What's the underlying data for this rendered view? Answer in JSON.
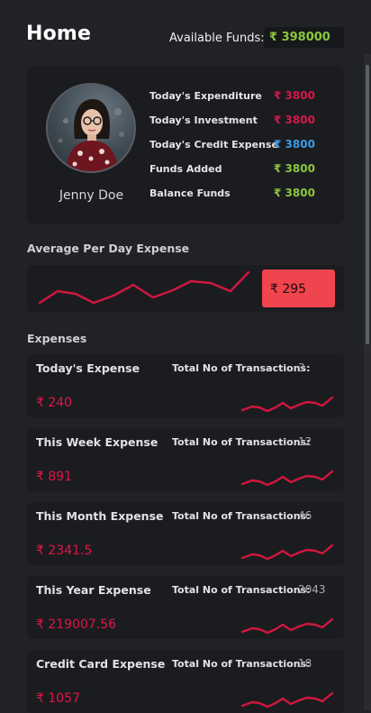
{
  "header": {
    "title": "Home",
    "funds_label": "Available Funds:",
    "funds_value": "₹ 398000"
  },
  "profile": {
    "name": "Jenny Doe",
    "stats": [
      {
        "label": "Today's Expenditure",
        "value": "₹ 3800",
        "color": "#d5184b"
      },
      {
        "label": "Today's Investment",
        "value": "₹ 3800",
        "color": "#d5184b"
      },
      {
        "label": "Today's Credit Expense",
        "value": "₹ 3800",
        "color": "#3a9be6"
      },
      {
        "label": "Funds Added",
        "value": "₹ 3800",
        "color": "#8dc63f"
      },
      {
        "label": "Balance Funds",
        "value": "₹ 3800",
        "color": "#8dc63f"
      }
    ]
  },
  "average": {
    "title": "Average Per Day Expense",
    "value": "₹ 295"
  },
  "expenses": {
    "title": "Expenses",
    "tx_label": "Total No of Transactions:",
    "items": [
      {
        "title": "Today's Expense",
        "count": "3",
        "amount": "₹ 240"
      },
      {
        "title": "This Week Expense",
        "count": "12",
        "amount": "₹ 891"
      },
      {
        "title": "This Month Expense",
        "count": "46",
        "amount": "₹ 2341.5"
      },
      {
        "title": "This Year Expense",
        "count": "2043",
        "amount": "₹ 219007.56"
      },
      {
        "title": "Credit Card Expense",
        "count": "18",
        "amount": "₹ 1057"
      }
    ]
  },
  "colors": {
    "background": "#212226",
    "card": "#1b1c1f",
    "expense_red": "#e0174a",
    "funds_green": "#8dc63f",
    "credit_blue": "#3a9be6",
    "badge_red": "#f0444e"
  }
}
